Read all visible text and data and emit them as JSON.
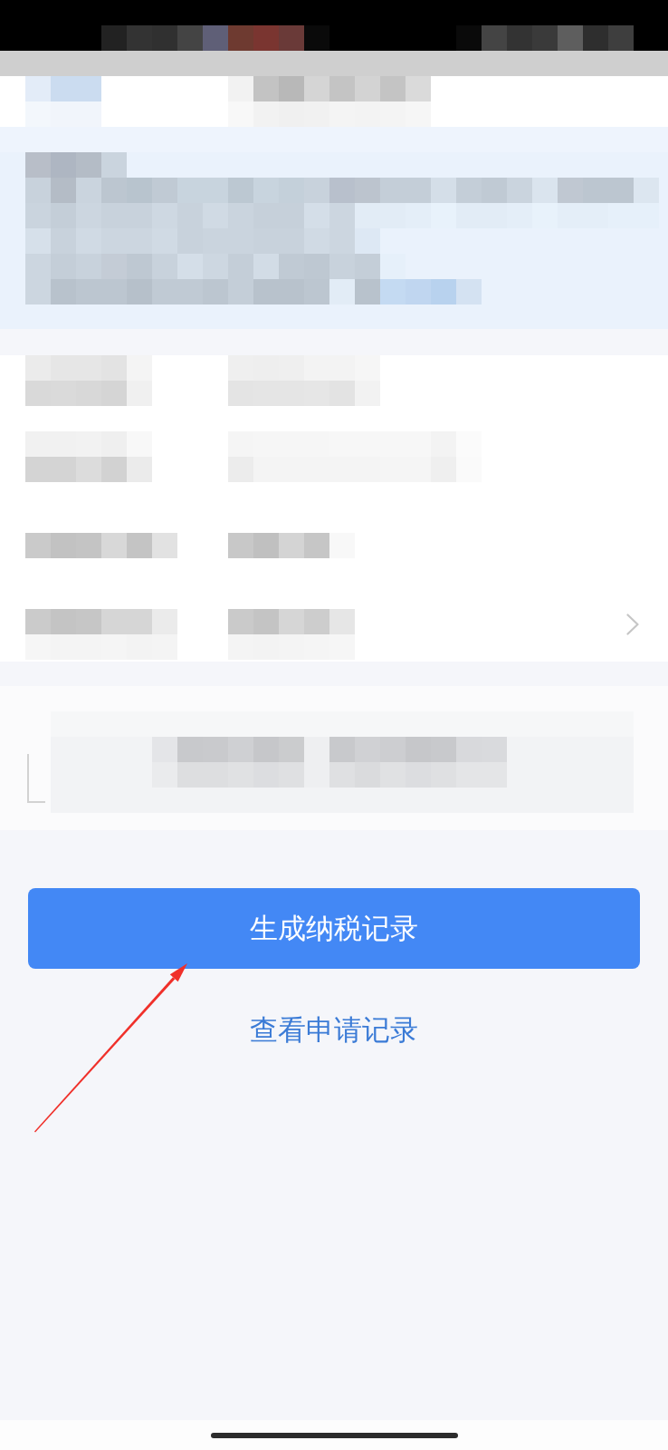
{
  "status_bar": {
    "kind": "pixelated"
  },
  "header": {
    "kind": "pixelated"
  },
  "notice_panel": {
    "kind": "pixelated"
  },
  "detail_rows": [
    {
      "kind": "pixelated",
      "chevron": false
    },
    {
      "kind": "pixelated",
      "chevron": false
    },
    {
      "kind": "pixelated",
      "chevron": false
    },
    {
      "kind": "pixelated",
      "chevron": true
    }
  ],
  "card": {
    "kind": "pixelated"
  },
  "primary_button": {
    "label": "生成纳税记录"
  },
  "secondary_link": {
    "label": "查看申请记录"
  },
  "annotation": {
    "kind": "arrow"
  }
}
